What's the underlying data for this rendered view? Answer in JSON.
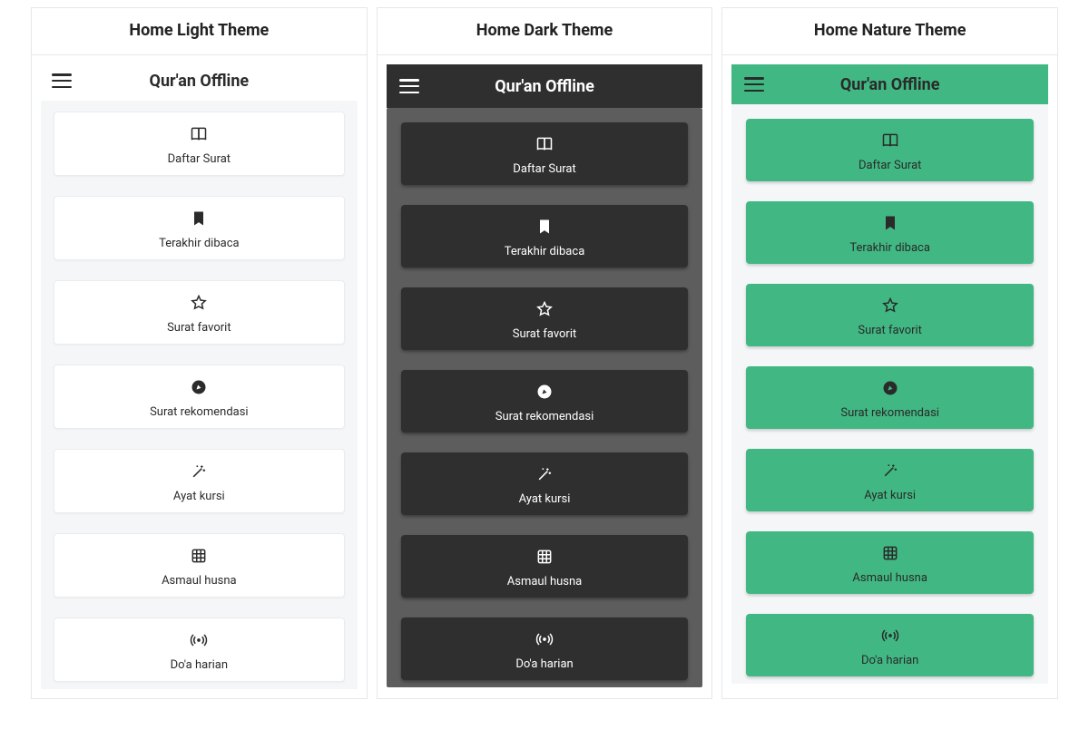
{
  "columns": [
    {
      "header": "Home Light Theme",
      "theme": "light"
    },
    {
      "header": "Home Dark Theme",
      "theme": "dark"
    },
    {
      "header": "Home Nature Theme",
      "theme": "nature"
    }
  ],
  "app": {
    "title": "Qur'an Offline"
  },
  "menu": [
    {
      "icon": "book",
      "label": "Daftar Surat"
    },
    {
      "icon": "bookmark",
      "label": "Terakhir dibaca"
    },
    {
      "icon": "star",
      "label": "Surat favorit"
    },
    {
      "icon": "compass",
      "label": "Surat rekomendasi"
    },
    {
      "icon": "wand",
      "label": "Ayat kursi"
    },
    {
      "icon": "grid",
      "label": "Asmaul husna"
    },
    {
      "icon": "broadcast",
      "label": "Do'a harian"
    }
  ]
}
